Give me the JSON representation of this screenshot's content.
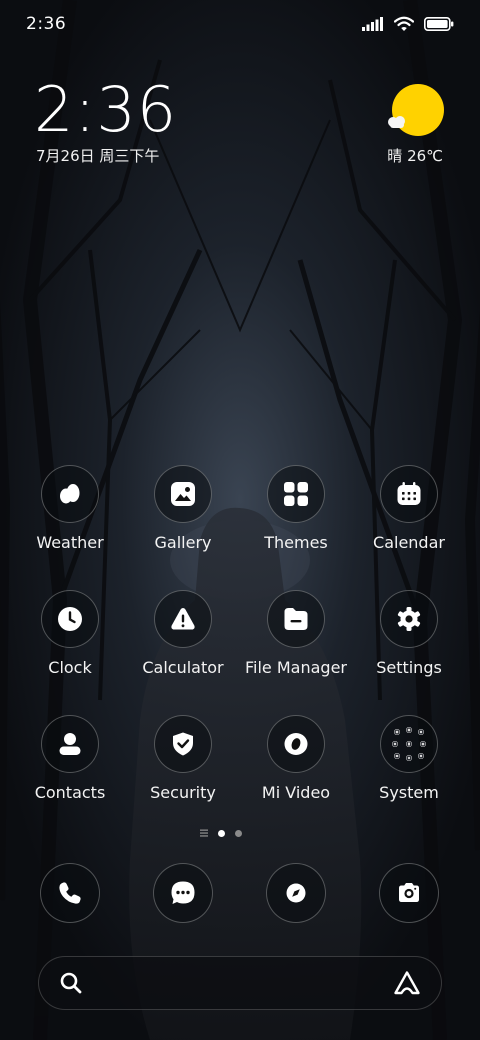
{
  "status_bar": {
    "time": "2:36",
    "icons": [
      "signal-icon",
      "wifi-icon",
      "battery-icon"
    ],
    "battery_level": 1.0
  },
  "clock_widget": {
    "time": "2:36",
    "date": "7月26日 周三下午"
  },
  "weather_widget": {
    "icon": "sun-cloud-icon",
    "text": "晴 26℃",
    "sun_color": "#ffd200"
  },
  "apps": [
    {
      "label": "Weather",
      "icon": "weather-icon"
    },
    {
      "label": "Gallery",
      "icon": "gallery-icon"
    },
    {
      "label": "Themes",
      "icon": "themes-icon"
    },
    {
      "label": "Calendar",
      "icon": "calendar-icon"
    },
    {
      "label": "Clock",
      "icon": "clock-icon"
    },
    {
      "label": "Calculator",
      "icon": "calculator-icon"
    },
    {
      "label": "File Manager",
      "icon": "file-manager-icon"
    },
    {
      "label": "Settings",
      "icon": "settings-icon"
    },
    {
      "label": "Contacts",
      "icon": "contacts-icon"
    },
    {
      "label": "Security",
      "icon": "security-icon"
    },
    {
      "label": "Mi Video",
      "icon": "mi-video-icon"
    },
    {
      "label": "System",
      "icon": "system-folder-icon"
    }
  ],
  "page_indicator": {
    "pages": 2,
    "current_page": 1,
    "active_color": "#ffffff",
    "inactive_color": "#8a8a8a"
  },
  "dock": [
    {
      "icon": "phone-icon"
    },
    {
      "icon": "messages-icon"
    },
    {
      "icon": "browser-icon"
    },
    {
      "icon": "camera-icon"
    }
  ],
  "search_bar": {
    "left_icon": "search-icon",
    "right_icon": "assistant-icon"
  }
}
